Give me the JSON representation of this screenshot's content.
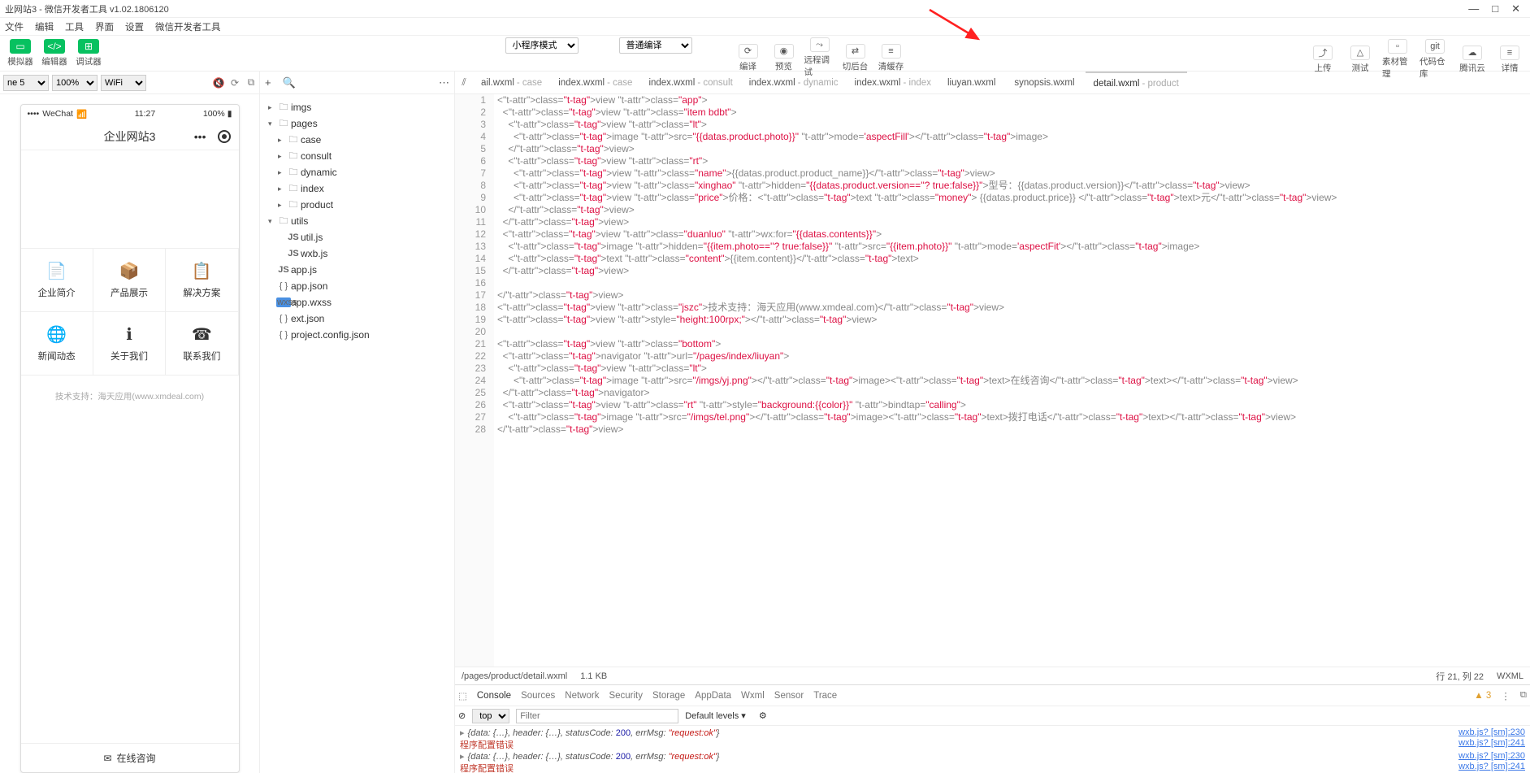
{
  "titlebar": {
    "title": "业网站3 - 微信开发者工具 v1.02.1806120"
  },
  "menubar": [
    "文件",
    "编辑",
    "工具",
    "界面",
    "设置",
    "微信开发者工具"
  ],
  "left_tools": [
    {
      "icon": "▭",
      "label": "模拟器"
    },
    {
      "icon": "</>",
      "label": "编辑器"
    },
    {
      "icon": "⊞",
      "label": "调试器"
    }
  ],
  "mid_selects": {
    "mode": "小程序模式",
    "compile": "普通编译"
  },
  "mid_tools": [
    {
      "icon": "⟳",
      "label": "编译"
    },
    {
      "icon": "◉",
      "label": "预览"
    },
    {
      "icon": "⤳",
      "label": "远程调试"
    },
    {
      "icon": "⇄",
      "label": "切后台"
    },
    {
      "icon": "≡",
      "label": "清缓存"
    }
  ],
  "right_tools": [
    {
      "icon": "⤴",
      "label": "上传"
    },
    {
      "icon": "△",
      "label": "测试"
    },
    {
      "icon": "▫",
      "label": "素材管理"
    },
    {
      "icon": "git",
      "label": "代码仓库"
    },
    {
      "icon": "☁",
      "label": "腾讯云"
    },
    {
      "icon": "≡",
      "label": "详情"
    }
  ],
  "sim_opts": {
    "device": "ne 5",
    "zoom": "100%",
    "network": "WiFi"
  },
  "phone": {
    "carrier": "WeChat",
    "time": "11:27",
    "battery": "100%",
    "nav_title": "企业网站3",
    "grid": [
      {
        "icon": "📄",
        "label": "企业简介"
      },
      {
        "icon": "📦",
        "label": "产品展示"
      },
      {
        "icon": "📋",
        "label": "解决方案"
      },
      {
        "icon": "🌐",
        "label": "新闻动态"
      },
      {
        "icon": "ℹ",
        "label": "关于我们"
      },
      {
        "icon": "☎",
        "label": "联系我们"
      }
    ],
    "footer": "技术支持：海天应用(www.xmdeal.com)",
    "consult": "在线咨询"
  },
  "tree": [
    {
      "caret": "▸",
      "icon": "folder",
      "name": "imgs",
      "ind": 0
    },
    {
      "caret": "▾",
      "icon": "folder",
      "name": "pages",
      "ind": 0
    },
    {
      "caret": "▸",
      "icon": "folder",
      "name": "case",
      "ind": 1
    },
    {
      "caret": "▸",
      "icon": "folder",
      "name": "consult",
      "ind": 1
    },
    {
      "caret": "▸",
      "icon": "folder",
      "name": "dynamic",
      "ind": 1
    },
    {
      "caret": "▸",
      "icon": "folder",
      "name": "index",
      "ind": 1
    },
    {
      "caret": "▸",
      "icon": "folder",
      "name": "product",
      "ind": 1
    },
    {
      "caret": "▾",
      "icon": "folder",
      "name": "utils",
      "ind": 0
    },
    {
      "caret": "",
      "icon": "js",
      "name": "util.js",
      "ind": 1
    },
    {
      "caret": "",
      "icon": "js",
      "name": "wxb.js",
      "ind": 1
    },
    {
      "caret": "",
      "icon": "js",
      "name": "app.js",
      "ind": 0
    },
    {
      "caret": "",
      "icon": "json",
      "name": "app.json",
      "ind": 0
    },
    {
      "caret": "",
      "icon": "wxss",
      "name": "app.wxss",
      "ind": 0
    },
    {
      "caret": "",
      "icon": "json",
      "name": "ext.json",
      "ind": 0
    },
    {
      "caret": "",
      "icon": "json",
      "name": "project.config.json",
      "ind": 0
    }
  ],
  "tabs": [
    {
      "name": "ail.wxml",
      "dim": "- case"
    },
    {
      "name": "index.wxml",
      "dim": "- case"
    },
    {
      "name": "index.wxml",
      "dim": "- consult"
    },
    {
      "name": "index.wxml",
      "dim": "- dynamic"
    },
    {
      "name": "index.wxml",
      "dim": "- index"
    },
    {
      "name": "liuyan.wxml",
      "dim": ""
    },
    {
      "name": "synopsis.wxml",
      "dim": ""
    },
    {
      "name": "detail.wxml",
      "dim": "- product",
      "active": true
    }
  ],
  "code_lines": [
    "<view class=\"app\">",
    "  <view class=\"item bdbt\">",
    "    <view class=\"lt\">",
    "      <image src=\"{{datas.product.photo}}\" mode='aspectFill'></image>",
    "    </view>",
    "    <view class=\"rt\">",
    "      <view class=\"name\">{{datas.product.product_name}}</view>",
    "      <view class=\"xinghao\" hidden=\"{{datas.product.version==''? true:false}}\">型号：{{datas.product.version}}</view>",
    "      <view class=\"price\">价格：<text class=\"money\"> {{datas.product.price}} </text>元</view>",
    "    </view>",
    "  </view>",
    "  <view class=\"duanluo\" wx:for=\"{{datas.contents}}\">",
    "    <image hidden=\"{{item.photo==''? true:false}}\" src=\"{{item.photo}}\" mode='aspectFit'></image>",
    "    <text class=\"content\">{{item.content}}</text>",
    "  </view>",
    "",
    "</view>",
    "<view class=\"jszc\">技术支持：海天应用(www.xmdeal.com)</view>",
    "<view style=\"height:100rpx;\"></view>",
    "",
    "<view class=\"bottom\">",
    "  <navigator url=\"/pages/index/liuyan\">",
    "    <view class=\"lt\">",
    "      <image src=\"/imgs/yj.png\"></image><text>在线咨询</text></view>",
    "  </navigator>",
    "  <view class=\"rt\" style=\"background:{{color}}\" bindtap=\"calling\">",
    "    <image src=\"/imgs/tel.png\"></image><text>拨打电话</text></view>",
    "</view>"
  ],
  "statusbar": {
    "path": "/pages/product/detail.wxml",
    "size": "1.1 KB",
    "pos": "行 21, 列 22",
    "lang": "WXML"
  },
  "devtools": {
    "tabs": [
      "Console",
      "Sources",
      "Network",
      "Security",
      "Storage",
      "AppData",
      "Wxml",
      "Sensor",
      "Trace"
    ],
    "active_tab": "Console",
    "warn_count": "3",
    "context": "top",
    "filter_placeholder": "Filter",
    "levels": "Default levels ▾",
    "rows": [
      {
        "kind": "log",
        "msg": "{data: {…}, header: {…}, statusCode: 200, errMsg: \"request:ok\"}",
        "src": "wxb.js? [sm]:230"
      },
      {
        "kind": "err",
        "msg": "程序配置错误",
        "src": "wxb.js? [sm]:241"
      },
      {
        "kind": "log",
        "msg": "{data: {…}, header: {…}, statusCode: 200, errMsg: \"request:ok\"}",
        "src": "wxb.js? [sm]:230"
      },
      {
        "kind": "err",
        "msg": "程序配置错误",
        "src": "wxb.js? [sm]:241"
      }
    ]
  }
}
